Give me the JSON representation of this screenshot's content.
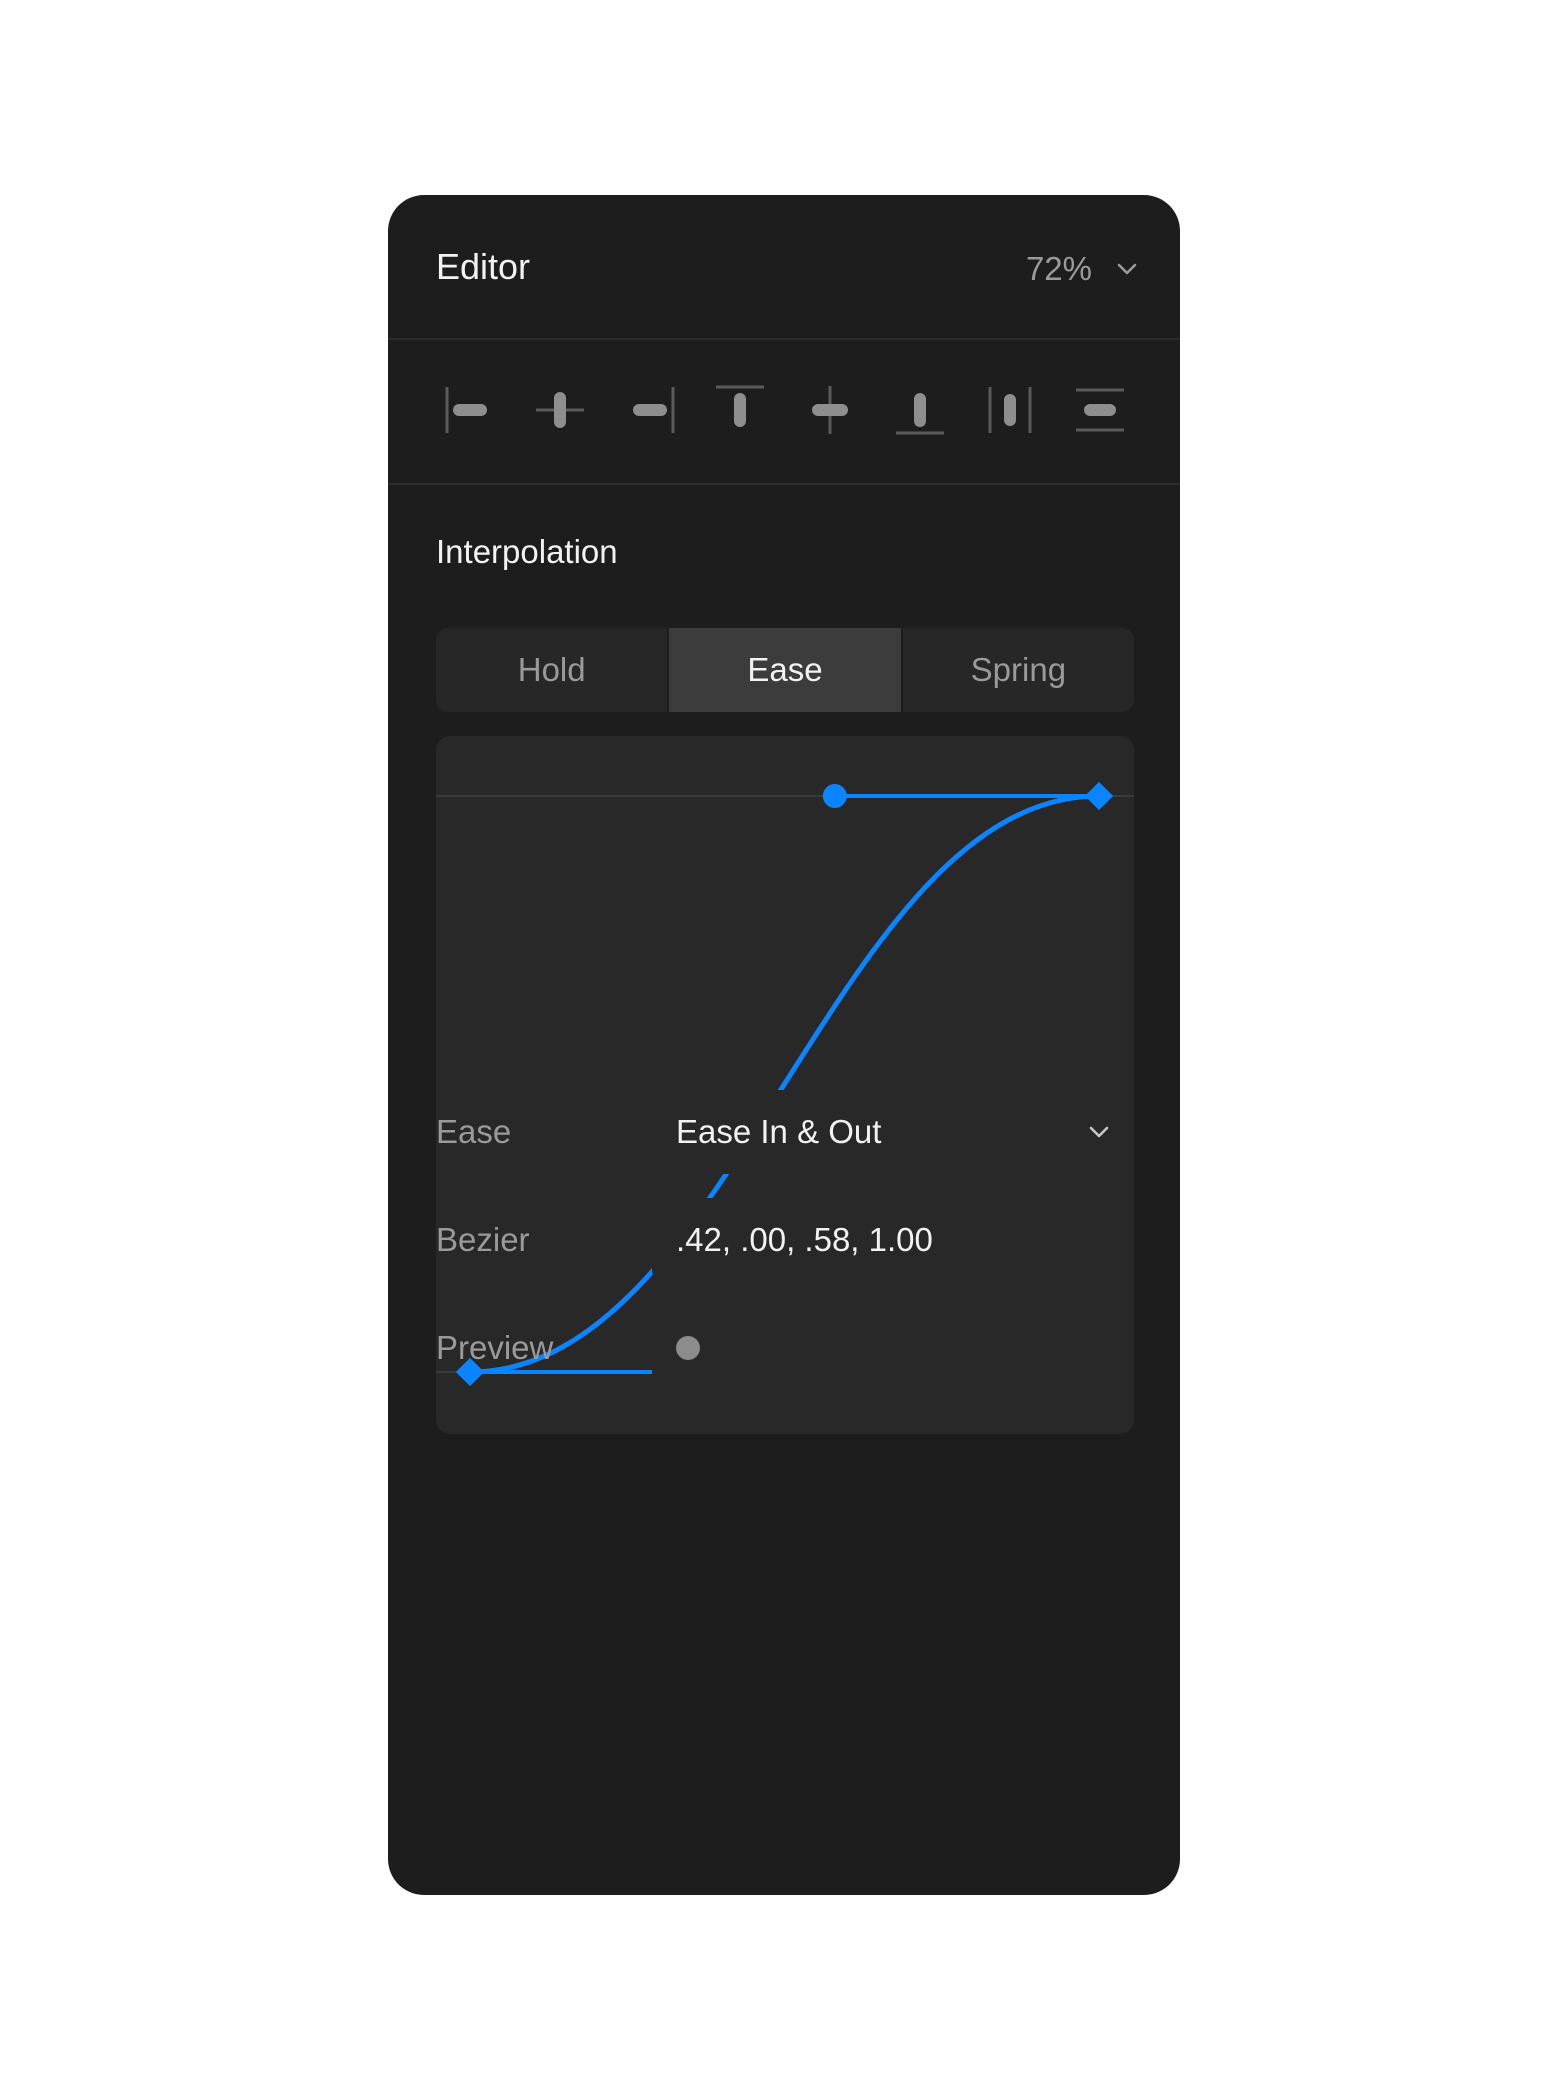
{
  "panel": {
    "title": "Editor",
    "zoom": "72%",
    "zoom_icon": "chevron-down-icon"
  },
  "toolbar": {
    "tools": [
      {
        "name": "align-left",
        "icon": "align-left-icon"
      },
      {
        "name": "align-horizontal-center",
        "icon": "align-horizontal-center-icon"
      },
      {
        "name": "align-right",
        "icon": "align-right-icon"
      },
      {
        "name": "align-top",
        "icon": "align-top-icon"
      },
      {
        "name": "align-vertical-center",
        "icon": "align-vertical-center-icon"
      },
      {
        "name": "align-bottom",
        "icon": "align-bottom-icon"
      },
      {
        "name": "distribute-horizontal",
        "icon": "distribute-horizontal-icon"
      },
      {
        "name": "distribute-vertical",
        "icon": "distribute-vertical-icon"
      }
    ]
  },
  "interpolation": {
    "title": "Interpolation",
    "modes": [
      "Hold",
      "Ease",
      "Spring"
    ],
    "active_mode": "Ease"
  },
  "curve": {
    "bezier": [
      0.42,
      0.0,
      0.58,
      1.0
    ],
    "color": "#0a84ff"
  },
  "properties": {
    "ease_label": "Ease",
    "ease_value": "Ease In & Out",
    "bezier_label": "Bezier",
    "bezier_value": ".42, .00, .58, 1.00",
    "preview_label": "Preview"
  },
  "colors": {
    "panel_bg": "#1d1d1d",
    "field_bg": "#282828",
    "accent": "#0a84ff",
    "text_primary": "#f2f2f2",
    "text_secondary": "#9a9a9a"
  }
}
